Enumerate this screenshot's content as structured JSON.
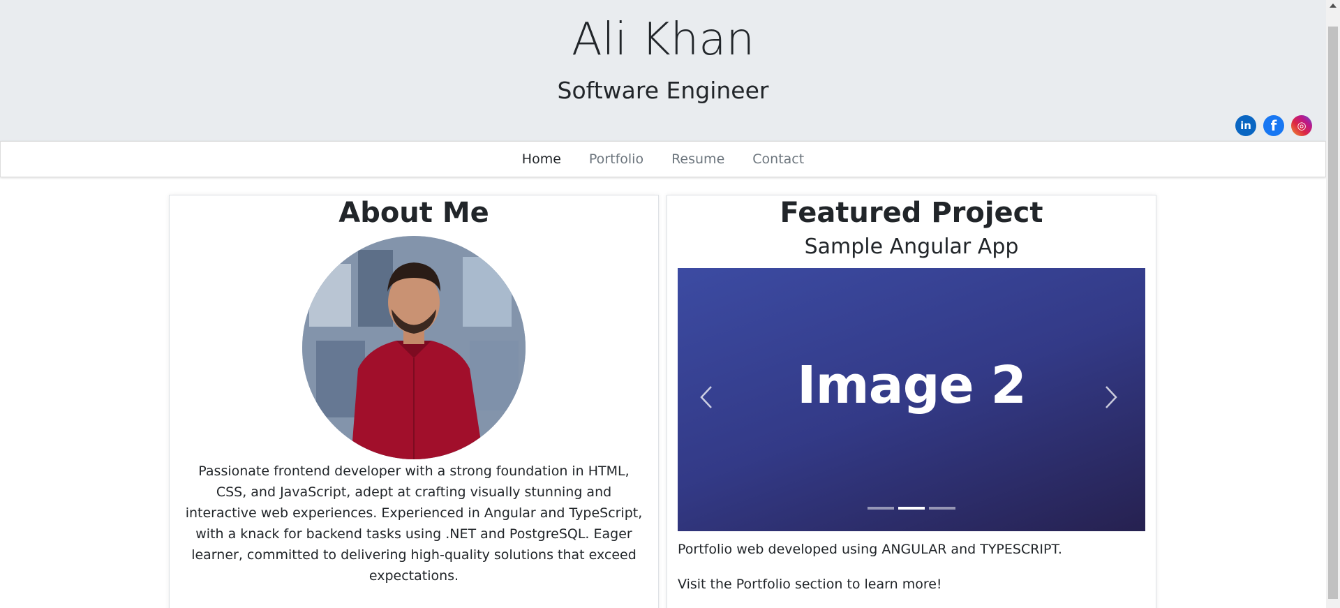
{
  "header": {
    "name": "Ali Khan",
    "role": "Software Engineer",
    "social": [
      {
        "label": "in",
        "icon": "linkedin-icon",
        "color": "#0a66c2"
      },
      {
        "label": "f",
        "icon": "facebook-icon",
        "color": "#1877f2"
      },
      {
        "label": "◎",
        "icon": "instagram-icon",
        "color": "#dc2743"
      }
    ]
  },
  "nav": {
    "items": [
      {
        "label": "Home",
        "active": true
      },
      {
        "label": "Portfolio",
        "active": false
      },
      {
        "label": "Resume",
        "active": false
      },
      {
        "label": "Contact",
        "active": false
      }
    ]
  },
  "about": {
    "title": "About Me",
    "text": "Passionate frontend developer with a strong foundation in HTML, CSS, and JavaScript, adept at crafting visually stunning and interactive web experiences. Experienced in Angular and TypeScript, with a knack for backend tasks using .NET and PostgreSQL. Eager learner, committed to delivering high-quality solutions that exceed expectations."
  },
  "project": {
    "title": "Featured Project",
    "subtitle": "Sample Angular App",
    "carousel": {
      "slide_label": "Image 2",
      "slide_count": 3,
      "active_index": 1
    },
    "description": "Portfolio web developed using ANGULAR and TYPESCRIPT.",
    "cta": "Visit the Portfolio section to learn more!"
  }
}
